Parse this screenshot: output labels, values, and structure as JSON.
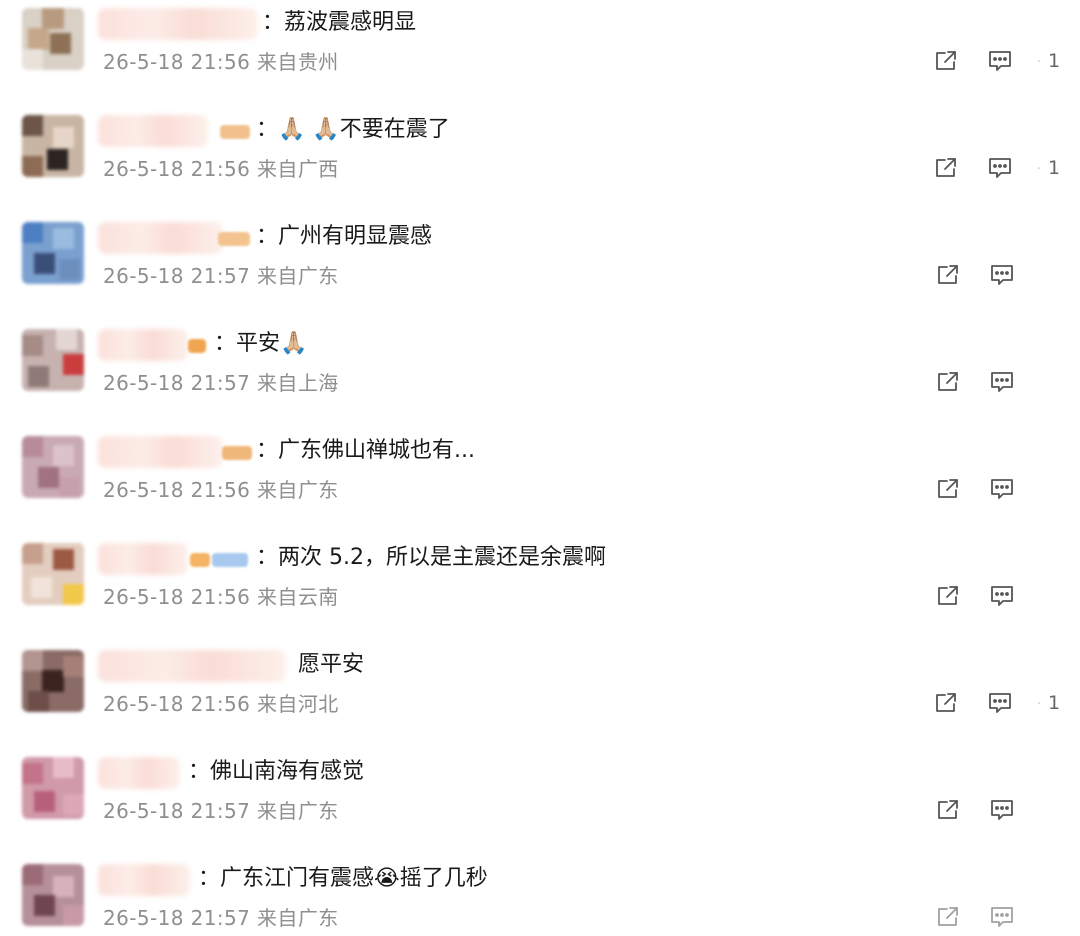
{
  "comments": [
    {
      "text": "：荔波震感明显",
      "time": "26-5-18 21:56",
      "location": "来自贵州",
      "likes": "1"
    },
    {
      "text": "：🙏🏼 🙏🏼不要在震了",
      "time": "26-5-18 21:56",
      "location": "来自广西",
      "likes": "1"
    },
    {
      "text": "：广州有明显震感",
      "time": "26-5-18 21:57",
      "location": "来自广东",
      "likes": ""
    },
    {
      "text": "：平安🙏🏼",
      "time": "26-5-18 21:57",
      "location": "来自上海",
      "likes": ""
    },
    {
      "text": "：广东佛山禅城也有...",
      "time": "26-5-18 21:56",
      "location": "来自广东",
      "likes": ""
    },
    {
      "text": "：两次 5.2，所以是主震还是余震啊",
      "time": "26-5-18 21:56",
      "location": "来自云南",
      "likes": ""
    },
    {
      "text": "愿平安",
      "time": "26-5-18 21:56",
      "location": "来自河北",
      "likes": "1"
    },
    {
      "text": "：佛山南海有感觉",
      "time": "26-5-18 21:57",
      "location": "来自广东",
      "likes": ""
    },
    {
      "text": "：广东江门有震感😭摇了几秒",
      "time": "26-5-18 21:57",
      "location": "来自广东",
      "likes": ""
    }
  ],
  "icons": {
    "forward": "share-icon",
    "comment": "comment-icon",
    "like": "thumbs-up-icon"
  },
  "colors": {
    "text": "#1a1a1a",
    "meta": "#8f8f8f",
    "icon": "#555555"
  }
}
